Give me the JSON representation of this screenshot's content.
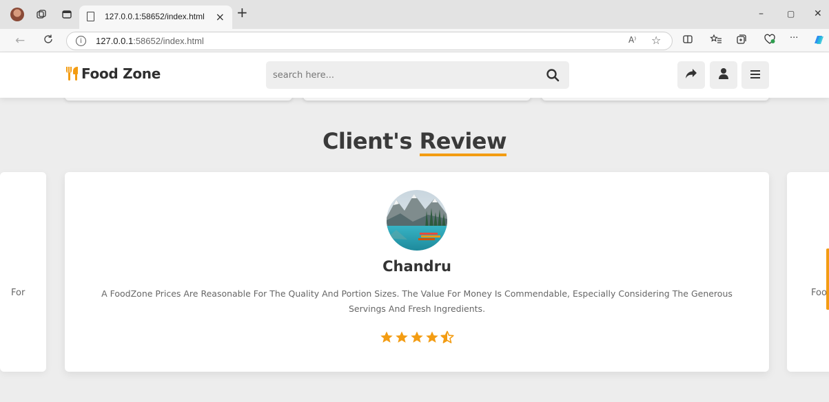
{
  "browser": {
    "tab_title": "127.0.0.1:58652/index.html",
    "url_host": "127.0.0.1",
    "url_path": ":58652/index.html",
    "minimize_glyph": "–",
    "restore_glyph": "▢",
    "close_glyph": "✕",
    "more_glyph": "···",
    "read_aloud_glyph": "A⁾"
  },
  "header": {
    "logo_text": "Food Zone",
    "search_placeholder": "search here...",
    "accent_color": "#f39c12"
  },
  "section": {
    "title_main": "Client's",
    "title_accent": "Review"
  },
  "reviews": {
    "left_peek_text": "For",
    "right_peek_text": "Foo",
    "main": {
      "name": "Chandru",
      "text": "A FoodZone Prices Are Reasonable For The Quality And Portion Sizes. The Value For Money Is Commendable, Especially Considering The Generous Servings And Fresh Ingredients.",
      "rating": 4.5,
      "max_rating": 5
    }
  },
  "icons": {
    "share": "share-icon",
    "user": "user-icon",
    "menu": "menu-icon",
    "search": "search-icon"
  }
}
